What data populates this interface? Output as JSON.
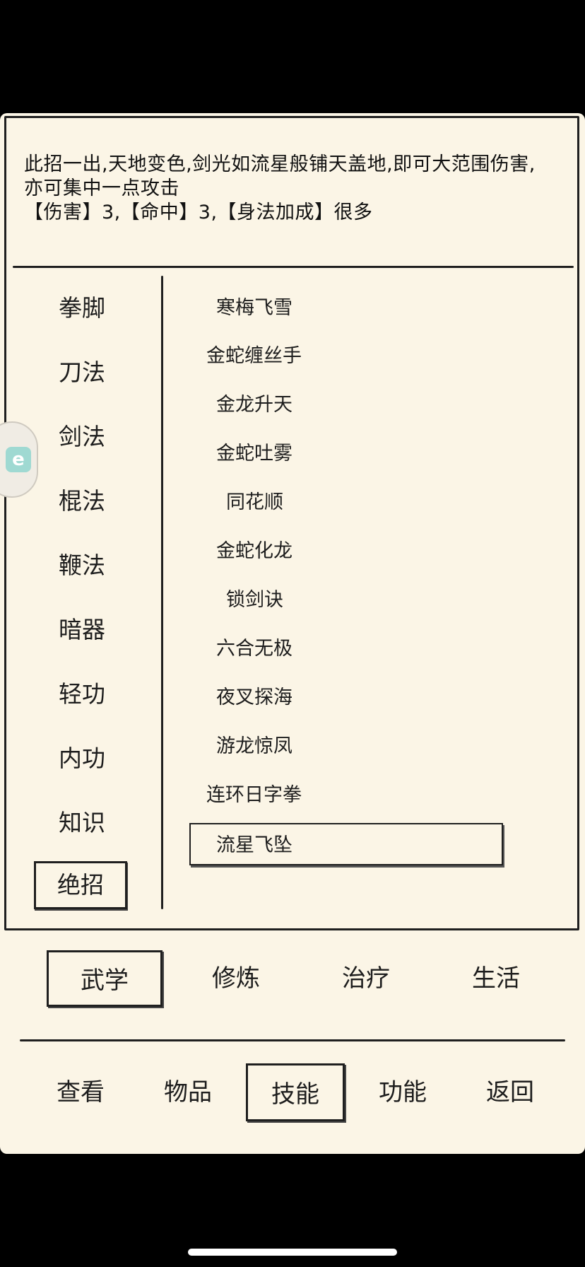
{
  "description": {
    "line1": "此招一出,天地变色,剑光如流星般铺天盖地,即可大范围伤害,",
    "line2": "亦可集中一点攻击",
    "line3": "【伤害】3,【命中】3,【身法加成】很多"
  },
  "categories": [
    {
      "label": "拳脚"
    },
    {
      "label": "刀法"
    },
    {
      "label": "剑法"
    },
    {
      "label": "棍法"
    },
    {
      "label": "鞭法"
    },
    {
      "label": "暗器"
    },
    {
      "label": "轻功"
    },
    {
      "label": "内功"
    },
    {
      "label": "知识"
    },
    {
      "label": "绝招"
    }
  ],
  "active_category": "绝招",
  "skills": [
    {
      "label": "寒梅飞雪"
    },
    {
      "label": "金蛇缠丝手"
    },
    {
      "label": "金龙升天"
    },
    {
      "label": "金蛇吐雾"
    },
    {
      "label": "同花顺"
    },
    {
      "label": "金蛇化龙"
    },
    {
      "label": "锁剑诀"
    },
    {
      "label": "六合无极"
    },
    {
      "label": "夜叉探海"
    },
    {
      "label": "游龙惊凤"
    },
    {
      "label": "连环日字拳"
    },
    {
      "label": "流星飞坠"
    }
  ],
  "selected_skill": "流星飞坠",
  "tabs": [
    {
      "label": "武学"
    },
    {
      "label": "修炼"
    },
    {
      "label": "治疗"
    },
    {
      "label": "生活"
    }
  ],
  "active_tab": "武学",
  "nav": [
    {
      "label": "查看"
    },
    {
      "label": "物品"
    },
    {
      "label": "技能"
    },
    {
      "label": "功能"
    },
    {
      "label": "返回"
    }
  ],
  "active_nav": "技能",
  "floating_button": {
    "icon": "app-shortcut-icon",
    "glyph": "e"
  }
}
